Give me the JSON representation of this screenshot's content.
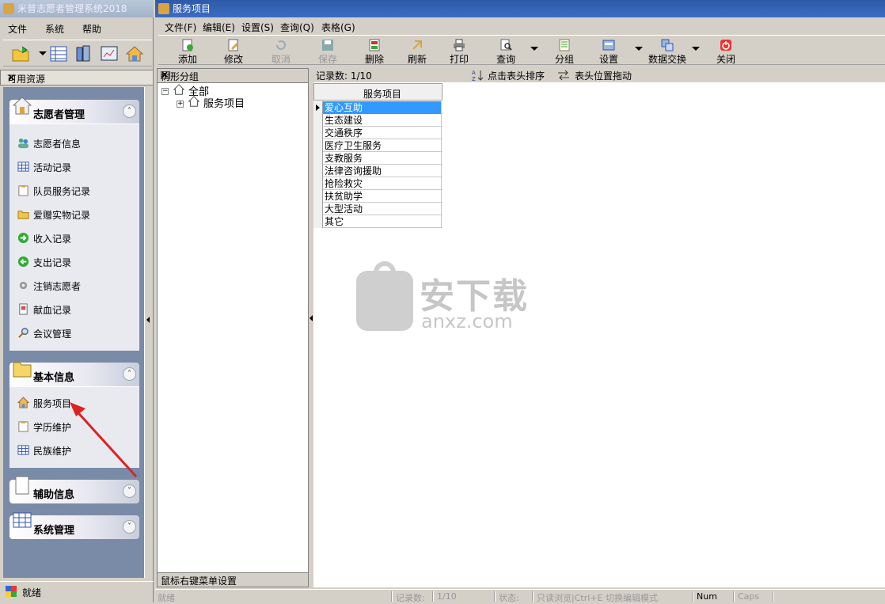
{
  "left_window": {
    "title": "米普志愿者管理系统2018",
    "menu": [
      "文件",
      "系统",
      "帮助"
    ],
    "resources_title": "可用资源",
    "groups": [
      {
        "label": "志愿者管理",
        "expanded": true,
        "items": [
          "志愿者信息",
          "活动记录",
          "队员服务记录",
          "爱赠实物记录",
          "收入记录",
          "支出记录",
          "注销志愿者",
          "献血记录",
          "会议管理"
        ]
      },
      {
        "label": "基本信息",
        "expanded": true,
        "items": [
          "服务项目",
          "学历维护",
          "民族维护"
        ]
      },
      {
        "label": "辅助信息",
        "expanded": false,
        "items": []
      },
      {
        "label": "系统管理",
        "expanded": false,
        "items": []
      }
    ],
    "status": "就绪",
    "collapse_glyph": "˄",
    "expand_glyph": "˅"
  },
  "right_window": {
    "title": "服务项目",
    "menu": [
      "文件(F)",
      "编辑(E)",
      "设置(S)",
      "查询(Q)",
      "表格(G)"
    ],
    "toolbar": [
      "添加",
      "修改",
      "取消",
      "保存",
      "删除",
      "刷新",
      "打印",
      "查询",
      "分组",
      "设置",
      "数据交换",
      "关闭"
    ],
    "tree_title": "树形分组",
    "tree": {
      "root": "全部",
      "child": "服务项目"
    },
    "tree_footer": "鼠标右键菜单设置",
    "record_count": "记录数: 1/10",
    "sort_hint": "点击表头排序",
    "drag_hint": "表头位置拖动",
    "grid_header": "服务项目",
    "rows": [
      "爱心互助",
      "生态建设",
      "交通秩序",
      "医疗卫生服务",
      "支教服务",
      "法律咨询援助",
      "抢险救灾",
      "扶贫助学",
      "大型活动",
      "其它"
    ],
    "selected_row": 0,
    "watermark": {
      "text": "安下载",
      "url": "anxz.com"
    },
    "status": {
      "ready": "就绪",
      "records_label": "记录数:",
      "records": "1/10",
      "state_label": "状态:",
      "state": "只读浏览|Ctrl+E 切换编辑模式",
      "num": "Num",
      "caps": "Caps"
    }
  }
}
